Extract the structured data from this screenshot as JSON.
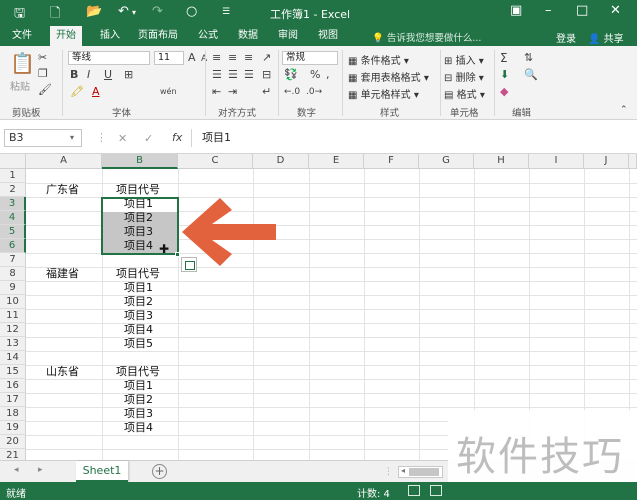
{
  "window": {
    "title": "工作簿1 - Excel",
    "qa_icons": [
      "save-icon",
      "new-file-icon",
      "open-folder-icon",
      "undo-icon",
      "redo-icon",
      "circle-icon",
      "customize-icon"
    ]
  },
  "ribbon_tabs": [
    {
      "label": "文件",
      "active": false
    },
    {
      "label": "开始",
      "active": true
    },
    {
      "label": "插入",
      "active": false
    },
    {
      "label": "页面布局",
      "active": false
    },
    {
      "label": "公式",
      "active": false
    },
    {
      "label": "数据",
      "active": false
    },
    {
      "label": "审阅",
      "active": false
    },
    {
      "label": "视图",
      "active": false
    }
  ],
  "tellme": "告诉我您想要做什么...",
  "account": {
    "login": "登录",
    "share": "共享"
  },
  "ribbon": {
    "clipboard": {
      "paste_label": "粘贴",
      "group": "剪贴板"
    },
    "font": {
      "font_name": "等线",
      "font_size": "11",
      "bold": "B",
      "italic": "I",
      "underline": "U",
      "grow": "A",
      "shrink": "A",
      "color_a": "A",
      "wen": "wén",
      "group": "字体"
    },
    "alignment": {
      "group": "对齐方式"
    },
    "number": {
      "format": "常规",
      "percent": "%",
      "comma": ",",
      "group": "数字"
    },
    "styles": {
      "conditional": "条件格式",
      "table": "套用表格格式",
      "cell": "单元格样式",
      "group": "样式"
    },
    "cells": {
      "insert": "插入",
      "delete": "删除",
      "format": "格式",
      "group": "单元格"
    },
    "editing": {
      "sigma": "Σ",
      "group": "编辑"
    }
  },
  "formula_bar": {
    "name_box": "B3",
    "cancel": "✕",
    "confirm": "✓",
    "fx": "fx",
    "content": "项目1"
  },
  "columns": [
    "A",
    "B",
    "C",
    "D",
    "E",
    "F",
    "G",
    "H",
    "I",
    "J"
  ],
  "rows": [
    "1",
    "2",
    "3",
    "4",
    "5",
    "6",
    "7",
    "8",
    "9",
    "10",
    "11",
    "12",
    "13",
    "14",
    "15",
    "16",
    "17",
    "18",
    "19",
    "20",
    "21"
  ],
  "cells": {
    "A2": "广东省",
    "B2": "项目代号",
    "B3": "项目1",
    "B4": "项目2",
    "B5": "项目3",
    "B6": "项目4",
    "A8": "福建省",
    "B8": "项目代号",
    "B9": "项目1",
    "B10": "项目2",
    "B11": "项目3",
    "B12": "项目4",
    "B13": "项目5",
    "A15": "山东省",
    "B15": "项目代号",
    "B16": "项目1",
    "B17": "项目2",
    "B18": "项目3",
    "B19": "项目4"
  },
  "selection": {
    "range": "B3:B6",
    "active": "B3"
  },
  "annotation": {
    "arrow_color": "#e2623d"
  },
  "sheets": [
    {
      "name": "Sheet1",
      "active": true
    }
  ],
  "status": {
    "ready": "就绪",
    "count": "计数: 4"
  },
  "watermark": "软件技巧",
  "colors": {
    "accent": "#217346",
    "selection": "#c6c6c6",
    "arrow": "#e2623d"
  }
}
